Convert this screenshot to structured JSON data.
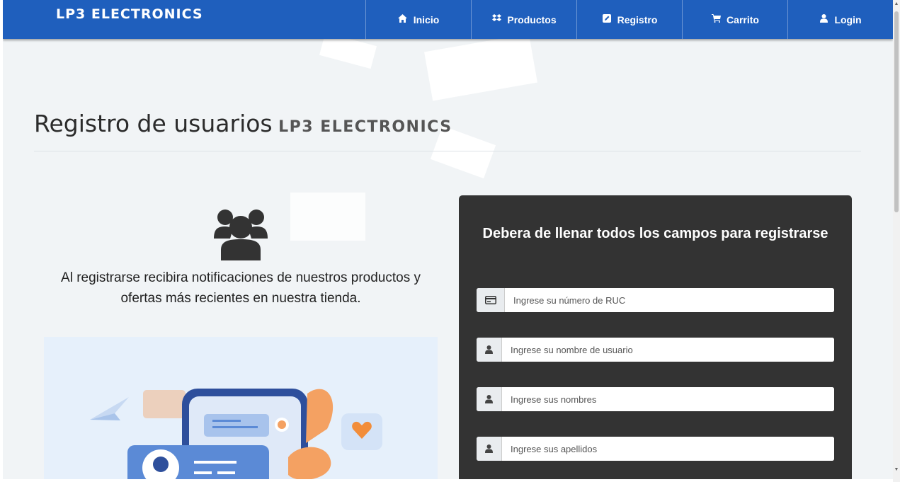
{
  "navbar": {
    "brand": "LP3 ELECTRONICS",
    "items": [
      {
        "label": "Inicio",
        "icon": "home-icon"
      },
      {
        "label": "Productos",
        "icon": "dropbox-icon"
      },
      {
        "label": "Registro",
        "icon": "edit-icon"
      },
      {
        "label": "Carrito",
        "icon": "cart-icon"
      },
      {
        "label": "Login",
        "icon": "user-icon"
      }
    ]
  },
  "header": {
    "title": "Registro de usuarios",
    "brand": "LP3 ELECTRONICS"
  },
  "intro": {
    "text": "Al registrarse recibira notificaciones de nuestros productos y ofertas más recientes en nuestra tienda."
  },
  "form": {
    "heading": "Debera de llenar todos los campos para registrarse",
    "fields": [
      {
        "placeholder": "Ingrese su número de RUC",
        "icon": "id-card-icon",
        "value": ""
      },
      {
        "placeholder": "Ingrese su nombre de usuario",
        "icon": "user-icon",
        "value": ""
      },
      {
        "placeholder": "Ingrese sus nombres",
        "icon": "user-icon",
        "value": ""
      },
      {
        "placeholder": "Ingrese sus apellidos",
        "icon": "user-icon",
        "value": ""
      }
    ]
  },
  "colors": {
    "navbar": "#1f5fbd",
    "panel": "#333333",
    "page_bg": "#f1f4f6"
  }
}
